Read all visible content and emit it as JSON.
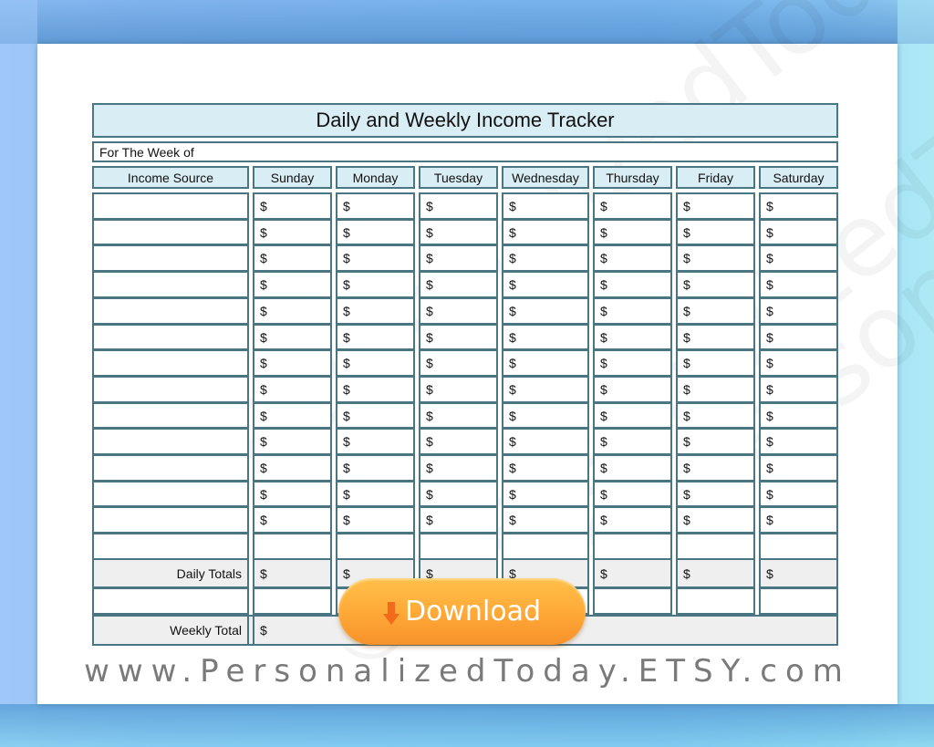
{
  "sheet": {
    "title": "Daily and Weekly Income Tracker",
    "week_label": "For The Week of",
    "columns": [
      {
        "key": "source",
        "label": "Income Source"
      },
      {
        "key": "sun",
        "label": "Sunday"
      },
      {
        "key": "mon",
        "label": "Monday"
      },
      {
        "key": "tue",
        "label": "Tuesday"
      },
      {
        "key": "wed",
        "label": "Wednesday"
      },
      {
        "key": "thu",
        "label": "Thursday"
      },
      {
        "key": "fri",
        "label": "Friday"
      },
      {
        "key": "sat",
        "label": "Saturday"
      }
    ],
    "currency_symbol": "$",
    "entry_rows": 13,
    "blank_rows_after_entries": 1,
    "daily_totals_label": "Daily Totals",
    "weekly_total_label": "Weekly Total"
  },
  "download_button": {
    "label": "Download",
    "icon": "download-arrow-icon",
    "color": "#ffac3a"
  },
  "footer": {
    "url": "www.PersonalizedToday.ETSY.com"
  },
  "watermark": {
    "text": "© PersonalizedToday"
  },
  "colors": {
    "header_fill": "#d9edf4",
    "border": "#4a7583",
    "totals_fill": "#efefef"
  }
}
